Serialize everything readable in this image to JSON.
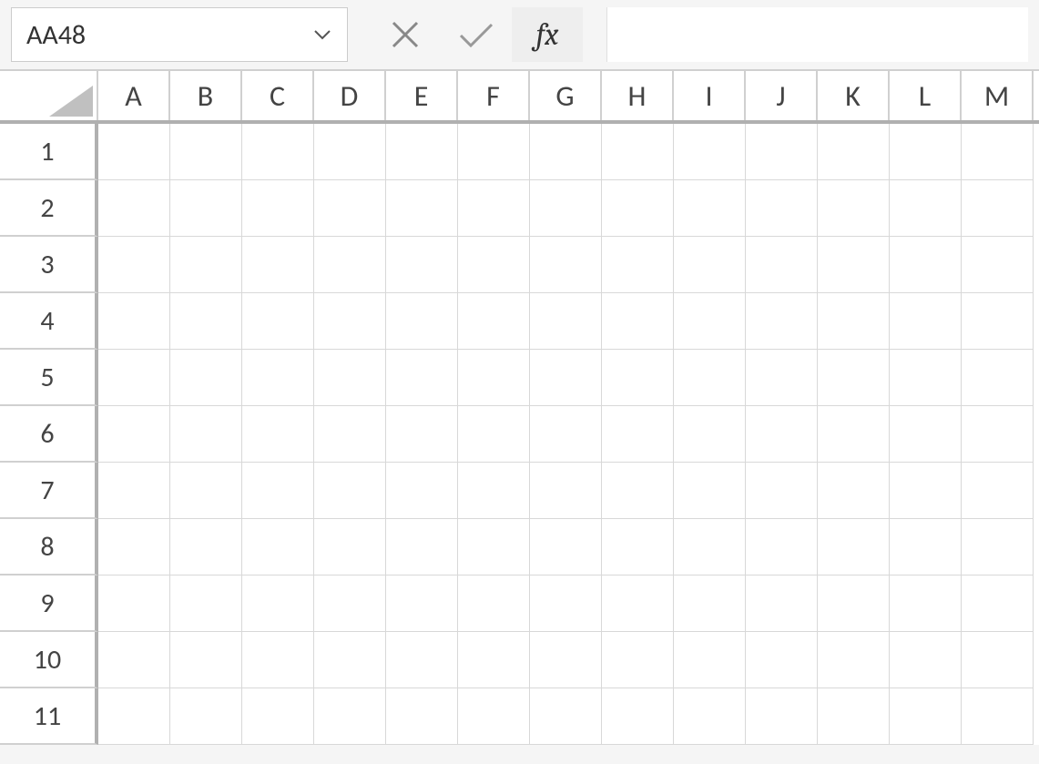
{
  "formula_bar": {
    "name_box_value": "AA48",
    "fx_label": "fx",
    "formula_value": ""
  },
  "columns": [
    "A",
    "B",
    "C",
    "D",
    "E",
    "F",
    "G",
    "H",
    "I",
    "J",
    "K",
    "L",
    "M"
  ],
  "rows": [
    "1",
    "2",
    "3",
    "4",
    "5",
    "6",
    "7",
    "8",
    "9",
    "10",
    "11"
  ],
  "cells": {}
}
